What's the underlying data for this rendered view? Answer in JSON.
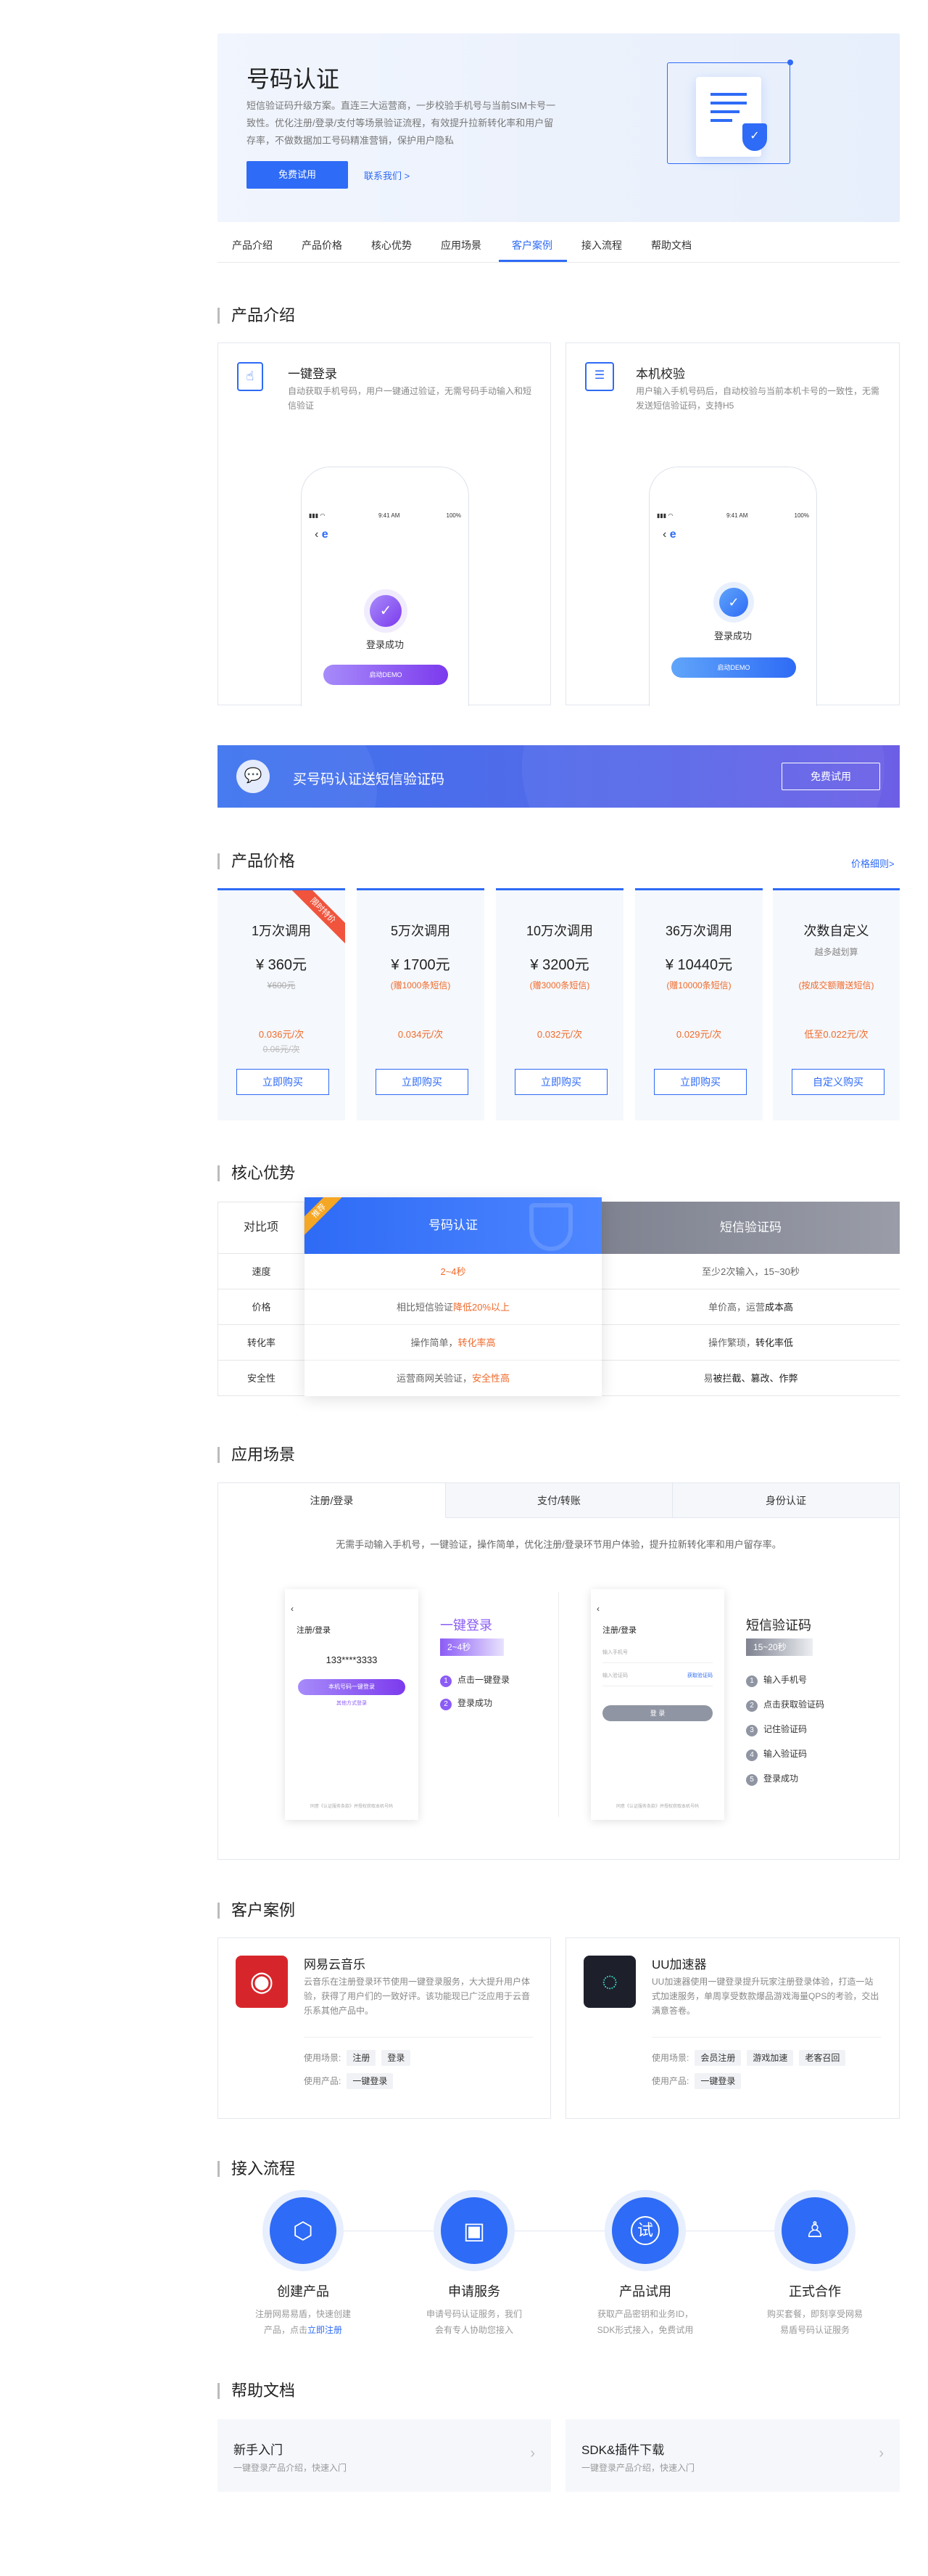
{
  "hero": {
    "title": "号码认证",
    "desc": "短信验证码升级方案。直连三大运营商，一步校验手机号与当前SIM卡号一致性。优化注册/登录/支付等场景验证流程，有效提升拉新转化率和用户留存率，不做数据加工号码精准营销，保护用户隐私",
    "btn_trial": "免费试用",
    "link_contact": "联系我们 >"
  },
  "tabs": [
    "产品介绍",
    "产品价格",
    "核心优势",
    "应用场景",
    "客户案例",
    "接入流程",
    "帮助文档"
  ],
  "active_tab": "客户案例",
  "intro": {
    "heading": "产品介绍",
    "cards": [
      {
        "title": "一键登录",
        "desc": "自动获取手机号码，用户一键通过验证，无需号码手动输入和短信验证",
        "status_time": "9:41 AM",
        "battery": "100%",
        "success": "登录成功",
        "demo_btn": "启动DEMO"
      },
      {
        "title": "本机校验",
        "desc": "用户输入手机号码后，自动校验与当前本机卡号的一致性，无需发送短信验证码，支持H5",
        "status_time": "9:41 AM",
        "battery": "100%",
        "success": "登录成功",
        "demo_btn": "启动DEMO"
      }
    ]
  },
  "banner": {
    "text": "买号码认证送短信验证码",
    "btn": "免费试用"
  },
  "pricing": {
    "heading": "产品价格",
    "detail_link": "价格细则>",
    "ribbon": "限时特价",
    "plans": [
      {
        "name": "1万次调用",
        "price": "¥ 360元",
        "orig": "¥600元",
        "gift": "",
        "unit": "0.036元/次",
        "unit_orig": "0.06元/次",
        "btn": "立即购买"
      },
      {
        "name": "5万次调用",
        "price": "¥ 1700元",
        "orig": "",
        "gift": "(赠1000条短信)",
        "unit": "0.034元/次",
        "unit_orig": "",
        "btn": "立即购买"
      },
      {
        "name": "10万次调用",
        "price": "¥ 3200元",
        "orig": "",
        "gift": "(赠3000条短信)",
        "unit": "0.032元/次",
        "unit_orig": "",
        "btn": "立即购买"
      },
      {
        "name": "36万次调用",
        "price": "¥ 10440元",
        "orig": "",
        "gift": "(赠10000条短信)",
        "unit": "0.029元/次",
        "unit_orig": "",
        "btn": "立即购买"
      },
      {
        "name": "次数自定义",
        "price": "越多越划算",
        "orig": "",
        "gift": "(按成交额赠送短信)",
        "unit": "低至0.022元/次",
        "unit_orig": "",
        "btn": "自定义购买"
      }
    ]
  },
  "advantage": {
    "heading": "核心优势",
    "ribbon": "推荐",
    "col0": "对比项",
    "col1": "号码认证",
    "col2": "短信验证码",
    "rows": [
      {
        "item": "速度",
        "a": "2~4秒",
        "b": "至少2次输入，15~30秒"
      },
      {
        "item": "价格",
        "a_pre": "相比短信验证",
        "a_hl": "降低20%以上",
        "b_pre": "单价高，运营",
        "b_hl": "成本高"
      },
      {
        "item": "转化率",
        "a_pre": "操作简单，",
        "a_hl": "转化率高",
        "b_pre": "操作繁琐，",
        "b_hl": "转化率低"
      },
      {
        "item": "安全性",
        "a_pre": "运营商网关验证，",
        "a_hl": "安全性高",
        "b_pre": "易",
        "b_hl": "被拦截、篡改、作弊"
      }
    ]
  },
  "scene": {
    "heading": "应用场景",
    "tabs": [
      "注册/登录",
      "支付/转账",
      "身份认证"
    ],
    "desc": "无需手动输入手机号，一键验证，操作简单，优化注册/登录环节用户体验，提升拉新转化率和用户留存率。",
    "left": {
      "screen_title": "注册/登录",
      "masked": "133****3333",
      "btn": "本机号码一键登录",
      "sub": "其他方式登录",
      "footer": "同意《认证服务条款》并授权获取本机号码",
      "title": "一键登录",
      "time": "2~4秒",
      "steps": [
        "点击一键登录",
        "登录成功"
      ]
    },
    "right": {
      "screen_title": "注册/登录",
      "ph1": "输入手机号",
      "ph2": "输入验证码",
      "get_code": "获取验证码",
      "btn": "登 录",
      "footer": "同意《认证服务条款》并授权获取本机号码",
      "title": "短信验证码",
      "time": "15~20秒",
      "steps": [
        "输入手机号",
        "点击获取验证码",
        "记住验证码",
        "输入验证码",
        "登录成功"
      ]
    }
  },
  "cases": {
    "heading": "客户案例",
    "items": [
      {
        "name": "网易云音乐",
        "desc": "云音乐在注册登录环节使用一键登录服务，大大提升用户体验，获得了用户们的一致好评。该功能现已广泛应用于云音乐系其他产品中。",
        "scene_label": "使用场景:",
        "scenes": [
          "注册",
          "登录"
        ],
        "product_label": "使用产品:",
        "products": [
          "一键登录"
        ]
      },
      {
        "name": "UU加速器",
        "desc": "UU加速器使用一键登录提升玩家注册登录体验，打造一站式加速服务，单周享受数款爆品游戏海量QPS的考验，交出满意答卷。",
        "scene_label": "使用场景:",
        "scenes": [
          "会员注册",
          "游戏加速",
          "老客召回"
        ],
        "product_label": "使用产品:",
        "products": [
          "一键登录"
        ]
      }
    ]
  },
  "flow": {
    "heading": "接入流程",
    "steps": [
      {
        "title": "创建产品",
        "desc": "注册网易易盾，快速创建产品，点击",
        "link": "立即注册"
      },
      {
        "title": "申请服务",
        "desc": "申请号码认证服务，我们会有专人协助您接入",
        "link": ""
      },
      {
        "title": "产品试用",
        "desc": "获取产品密钥和业务ID，SDK形式接入，免费试用",
        "link": ""
      },
      {
        "title": "正式合作",
        "desc": "购买套餐，即刻享受网易易盾号码认证服务",
        "link": ""
      }
    ],
    "circle_glyph": "试"
  },
  "help": {
    "heading": "帮助文档",
    "items": [
      {
        "title": "新手入门",
        "desc": "一键登录产品介绍，快速入门"
      },
      {
        "title": "SDK&插件下载",
        "desc": "一键登录产品介绍，快速入门"
      }
    ]
  },
  "colors": {
    "primary": "#2e6bf6",
    "orange": "#f06a2b",
    "purple": "#8b5cf6"
  }
}
